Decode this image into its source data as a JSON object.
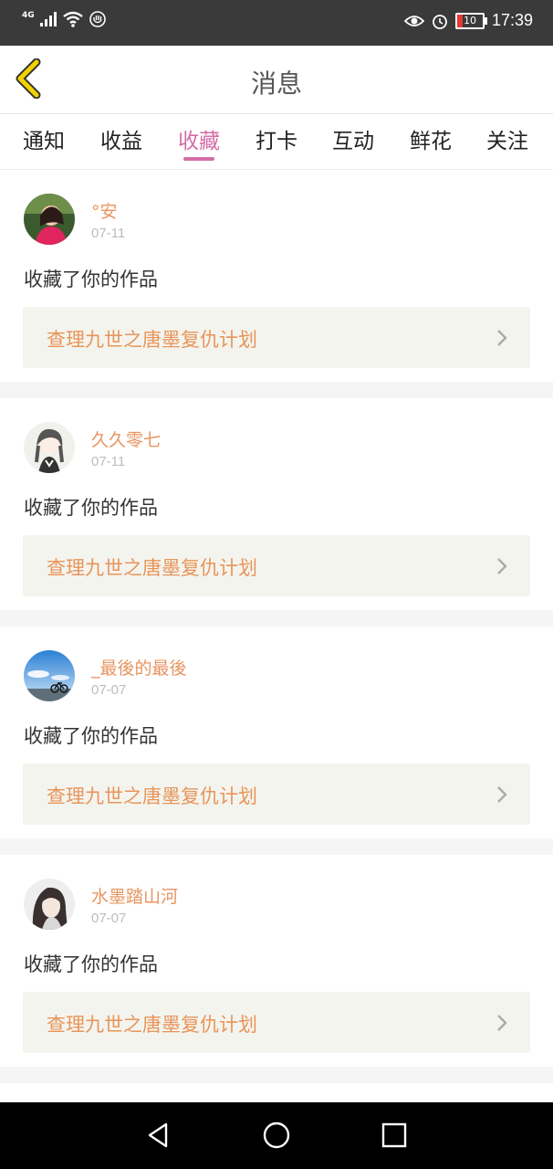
{
  "status_bar": {
    "network": "4G",
    "battery": "10",
    "time": "17:39",
    "icons": [
      "signal-icon",
      "wifi-icon",
      "hand-icon",
      "eye-icon",
      "alarm-icon",
      "battery-icon"
    ]
  },
  "header": {
    "title": "消息",
    "back_icon": "back-chevron-icon"
  },
  "tabs": [
    {
      "label": "通知"
    },
    {
      "label": "收益"
    },
    {
      "label": "收藏"
    },
    {
      "label": "打卡"
    },
    {
      "label": "互动"
    },
    {
      "label": "鲜花"
    },
    {
      "label": "关注"
    }
  ],
  "active_tab": "收藏",
  "messages": [
    {
      "user": "°安",
      "date": "07-11",
      "action": "收藏了你的作品",
      "work": "查理九世之唐墨复仇计划"
    },
    {
      "user": "久久零七",
      "date": "07-11",
      "action": "收藏了你的作品",
      "work": "查理九世之唐墨复仇计划"
    },
    {
      "user": "_最後的最後",
      "date": "07-07",
      "action": "收藏了你的作品",
      "work": "查理九世之唐墨复仇计划"
    },
    {
      "user": "水墨踏山河",
      "date": "07-07",
      "action": "收藏了你的作品",
      "work": "查理九世之唐墨复仇计划"
    }
  ],
  "colors": {
    "accent": "#d46da7",
    "username": "#e89560",
    "work_title": "#e8955a",
    "back_icon": "#e5c100"
  },
  "navbar": {
    "icons": [
      "nav-back-icon",
      "nav-home-icon",
      "nav-recents-icon"
    ]
  }
}
